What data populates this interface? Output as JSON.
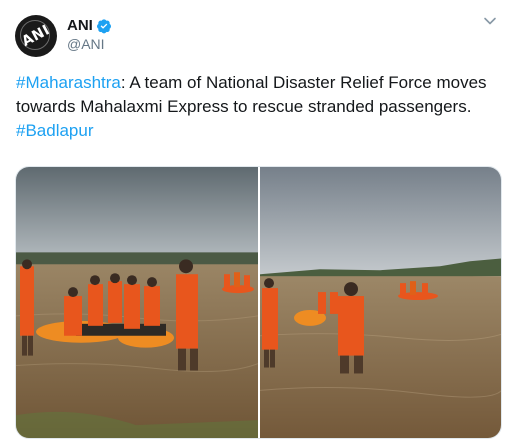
{
  "tweet": {
    "author": {
      "display_name": "ANI",
      "handle": "@ANI",
      "verified": true,
      "avatar_logo_text": "ANI"
    },
    "text": {
      "hashtag_1": "#Maharashtra",
      "body": ": A team of National Disaster Relief Force moves towards Mahalaxmi Express to rescue stranded passengers. ",
      "hashtag_2": "#Badlapur"
    },
    "media": {
      "photos": [
        {
          "icon": "flood-rescue-photo-boats"
        },
        {
          "icon": "flood-rescue-photo-wading"
        }
      ]
    }
  },
  "colors": {
    "link_blue": "#1da1f2",
    "verified_blue": "#1da1f2",
    "secondary_text": "#657786",
    "rescue_orange": "#e8561d",
    "water_brown": "#8a6e4a"
  }
}
